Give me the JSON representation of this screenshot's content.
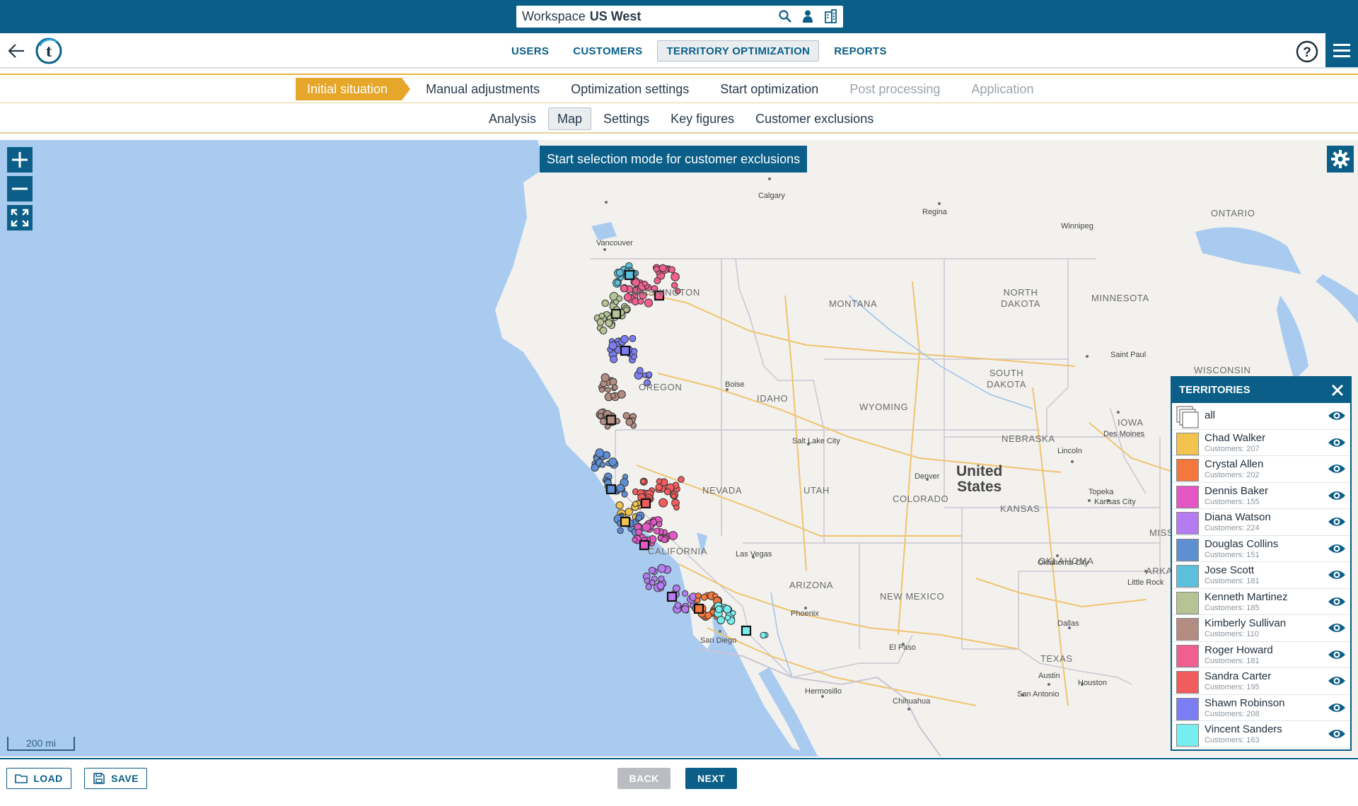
{
  "workspace": {
    "label": "Workspace",
    "name": "US West"
  },
  "nav": {
    "tabs": [
      {
        "label": "USERS"
      },
      {
        "label": "CUSTOMERS"
      },
      {
        "label": "TERRITORY OPTIMIZATION",
        "active": true
      },
      {
        "label": "REPORTS"
      }
    ]
  },
  "steps": [
    {
      "label": "Initial situation",
      "state": "active"
    },
    {
      "label": "Manual adjustments",
      "state": "enabled"
    },
    {
      "label": "Optimization settings",
      "state": "enabled"
    },
    {
      "label": "Start optimization",
      "state": "enabled"
    },
    {
      "label": "Post processing",
      "state": "disabled"
    },
    {
      "label": "Application",
      "state": "disabled"
    }
  ],
  "subtabs": [
    {
      "label": "Analysis"
    },
    {
      "label": "Map",
      "active": true
    },
    {
      "label": "Settings"
    },
    {
      "label": "Key figures"
    },
    {
      "label": "Customer exclusions"
    }
  ],
  "map": {
    "selection_button": "Start selection mode for customer exclusions",
    "scale_label": "200 mi",
    "country_label": "United\nStates",
    "state_labels": [
      "MONTANA",
      "NORTH DAKOTA",
      "MINNESOTA",
      "SOUTH DAKOTA",
      "WISCONSIN",
      "OREGON",
      "IDAHO",
      "WYOMING",
      "NEBRASKA",
      "IOWA",
      "NEVADA",
      "UTAH",
      "COLORADO",
      "KANSAS",
      "MISSOURI",
      "CALIFORNIA",
      "ARIZONA",
      "NEW MEXICO",
      "OKLAHOMA",
      "ARKANSAS",
      "TEXAS",
      "ONTARIO",
      "WASHINGTON"
    ],
    "city_labels": [
      "Calgary",
      "Regina",
      "Winnipeg",
      "Vancouver",
      "Saint Paul",
      "Boise",
      "Salt Lake City",
      "Denver",
      "Lincoln",
      "Des Moines",
      "Topeka",
      "Kansas City",
      "Las Vegas",
      "Phoenix",
      "Oklahoma City",
      "Little Rock",
      "Dallas",
      "El Paso",
      "Austin",
      "Houston",
      "San Antonio",
      "Hermosillo",
      "Chihuahua",
      "San Diego"
    ]
  },
  "territories": {
    "title": "TERRITORIES",
    "all_label": "all",
    "items": [
      {
        "name": "Chad Walker",
        "count": "Customers: 207",
        "color": "#f2c44e"
      },
      {
        "name": "Crystal Allen",
        "count": "Customers: 202",
        "color": "#f4773c"
      },
      {
        "name": "Dennis Baker",
        "count": "Customers: 155",
        "color": "#e357c4"
      },
      {
        "name": "Diana Watson",
        "count": "Customers: 224",
        "color": "#b57cf2"
      },
      {
        "name": "Douglas Collins",
        "count": "Customers: 151",
        "color": "#5f8fd3"
      },
      {
        "name": "Jose Scott",
        "count": "Customers: 181",
        "color": "#5cc0dc"
      },
      {
        "name": "Kenneth Martinez",
        "count": "Customers: 185",
        "color": "#b5c395"
      },
      {
        "name": "Kimberly Sullivan",
        "count": "Customers: 110",
        "color": "#b38c82"
      },
      {
        "name": "Roger Howard",
        "count": "Customers: 181",
        "color": "#ef5f8f"
      },
      {
        "name": "Sandra Carter",
        "count": "Customers: 195",
        "color": "#f25c5c"
      },
      {
        "name": "Shawn Robinson",
        "count": "Customers: 208",
        "color": "#7b7df2"
      },
      {
        "name": "Vincent Sanders",
        "count": "Customers: 163",
        "color": "#76eef0"
      }
    ]
  },
  "footer": {
    "load_label": "LOAD",
    "save_label": "SAVE",
    "back_label": "BACK",
    "next_label": "NEXT"
  },
  "colors": {
    "primary": "#0a5e87",
    "step_active": "#e5a62a",
    "water": "#aacbf0",
    "land": "#f2f1ee"
  }
}
